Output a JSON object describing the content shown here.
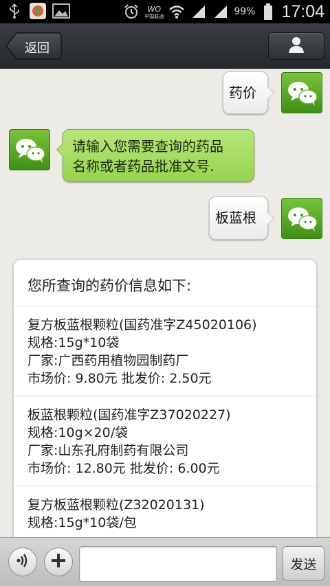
{
  "status_bar": {
    "time": "17:04",
    "battery": "99%",
    "carrier": "中国联通",
    "icons": [
      "usb-icon",
      "app-icon",
      "picture-icon",
      "alarm-icon",
      "network-icon",
      "wifi-icon",
      "signal-icon",
      "battery-icon"
    ]
  },
  "header": {
    "back_label": "返回",
    "profile_icon": "person-icon"
  },
  "chat": {
    "messages": [
      {
        "from": "me",
        "text": "药价"
      },
      {
        "from": "bot",
        "lines": [
          "请输入您需要查询的药品",
          "名称或者药品批准文号."
        ]
      },
      {
        "from": "me",
        "text": "板蓝根"
      }
    ],
    "result": {
      "title": "您所查询的药价信息如下:",
      "items": [
        {
          "name": "复方板蓝根颗粒(国药准字Z45020106)",
          "spec": "规格:15g*10袋",
          "maker": "厂家:广西药用植物园制药厂",
          "price": "市场价: 9.80元 批发价: 2.50元"
        },
        {
          "name": "板蓝根颗粒(国药准字Z37020227)",
          "spec": "规格:10g×20/袋",
          "maker": "厂家:山东孔府制药有限公司",
          "price": "市场价: 12.80元 批发价: 6.00元"
        },
        {
          "name": "复方板蓝根颗粒(Z32020131)",
          "spec": "规格:15g*10袋/包"
        }
      ]
    }
  },
  "input_bar": {
    "voice_icon": "voice-icon",
    "plus_icon": "plus-icon",
    "text_value": "",
    "send_label": "发送"
  },
  "colors": {
    "bot_bubble": "#a6dd60",
    "avatar_green": "#5aaa25",
    "chat_background": "#ecebe6"
  }
}
